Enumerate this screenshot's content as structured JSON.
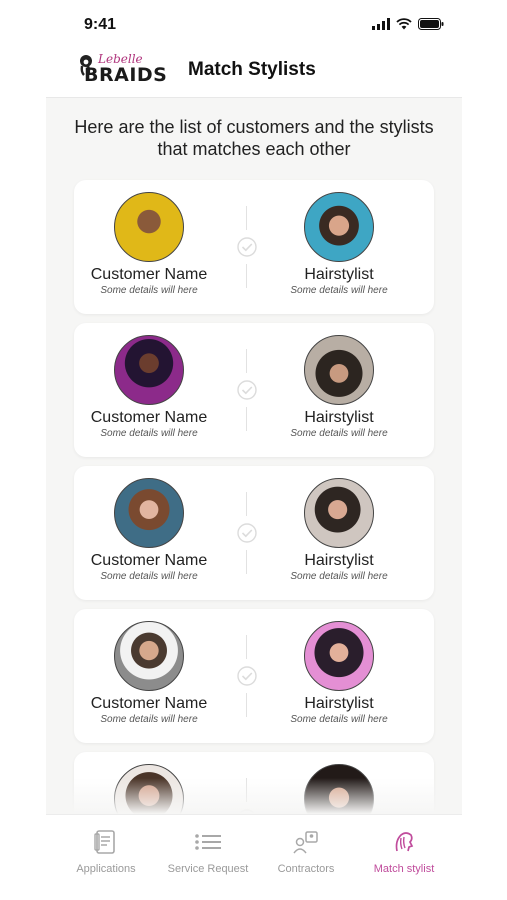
{
  "status": {
    "time": "9:41"
  },
  "header": {
    "logo_script": "Lebelle",
    "logo_word": "BRAIDS",
    "title": "Match Stylists"
  },
  "intro_text": "Here are the list of customers and the stylists that matches each other",
  "matches": [
    {
      "customer_name": "Customer Name",
      "customer_details": "Some details will here",
      "stylist_name": "Hairstylist",
      "stylist_details": "Some details will here"
    },
    {
      "customer_name": "Customer Name",
      "customer_details": "Some details will here",
      "stylist_name": "Hairstylist",
      "stylist_details": "Some details will here"
    },
    {
      "customer_name": "Customer Name",
      "customer_details": "Some details will here",
      "stylist_name": "Hairstylist",
      "stylist_details": "Some details will here"
    },
    {
      "customer_name": "Customer Name",
      "customer_details": "Some details will here",
      "stylist_name": "Hairstylist",
      "stylist_details": "Some details will here"
    },
    {
      "customer_name": "",
      "customer_details": "",
      "stylist_name": "",
      "stylist_details": ""
    }
  ],
  "nav": [
    {
      "label": "Applications",
      "icon": "document-icon",
      "active": false
    },
    {
      "label": "Service Request",
      "icon": "list-icon",
      "active": false
    },
    {
      "label": "Contractors",
      "icon": "contractors-icon",
      "active": false
    },
    {
      "label": "Match stylist",
      "icon": "match-stylist-icon",
      "active": true
    }
  ],
  "colors": {
    "accent": "#c04c9c",
    "background": "#f6f6f5"
  }
}
